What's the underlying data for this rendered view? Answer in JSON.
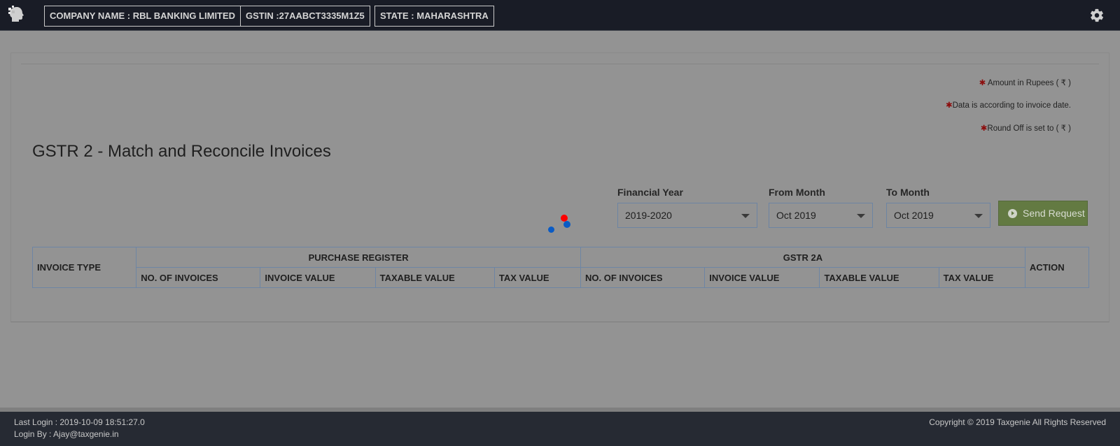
{
  "header": {
    "company": "COMPANY NAME : RBL BANKING LIMITED",
    "gstin": "GSTIN :27AABCT3335M1Z5",
    "state": "STATE : MAHARASHTRA",
    "logo_icon": "brain-logo-icon",
    "settings_icon": "gear-icon"
  },
  "notes": {
    "amount": "Amount in Rupees ( ₹ )",
    "data": "Data is according to invoice date.",
    "roundoff": "Round Off is set to ( ₹ )"
  },
  "page": {
    "title": "GSTR 2 - Match and Reconcile Invoices"
  },
  "filters": {
    "financial_year_label": "Financial Year",
    "financial_year_value": "2019-2020",
    "from_month_label": "From Month",
    "from_month_value": "Oct 2019",
    "to_month_label": "To Month",
    "to_month_value": "Oct 2019",
    "send_request_label": "Send Request"
  },
  "table": {
    "invoice_type": "INVOICE TYPE",
    "purchase_register": "PURCHASE REGISTER",
    "gstr2a": "GSTR 2A",
    "action": "ACTION",
    "sub_columns": [
      "NO. OF INVOICES",
      "INVOICE VALUE",
      "TAXABLE VALUE",
      "TAX VALUE",
      "NO. OF INVOICES",
      "INVOICE VALUE",
      "TAXABLE VALUE",
      "TAX VALUE"
    ]
  },
  "footer": {
    "last_login": "Last Login : 2019-10-09 18:51:27.0",
    "login_by": "Login By : Ajay@taxgenie.in",
    "copyright": "Copyright © 2019 Taxgenie All Rights Reserved"
  },
  "colors": {
    "topbar": "#191c26",
    "overlay_bg": "#939393",
    "send_button": "#637a42",
    "spinner_red": "#ff0000",
    "spinner_blue": "#0a5bc4",
    "note_star": "#8c0d0d"
  }
}
